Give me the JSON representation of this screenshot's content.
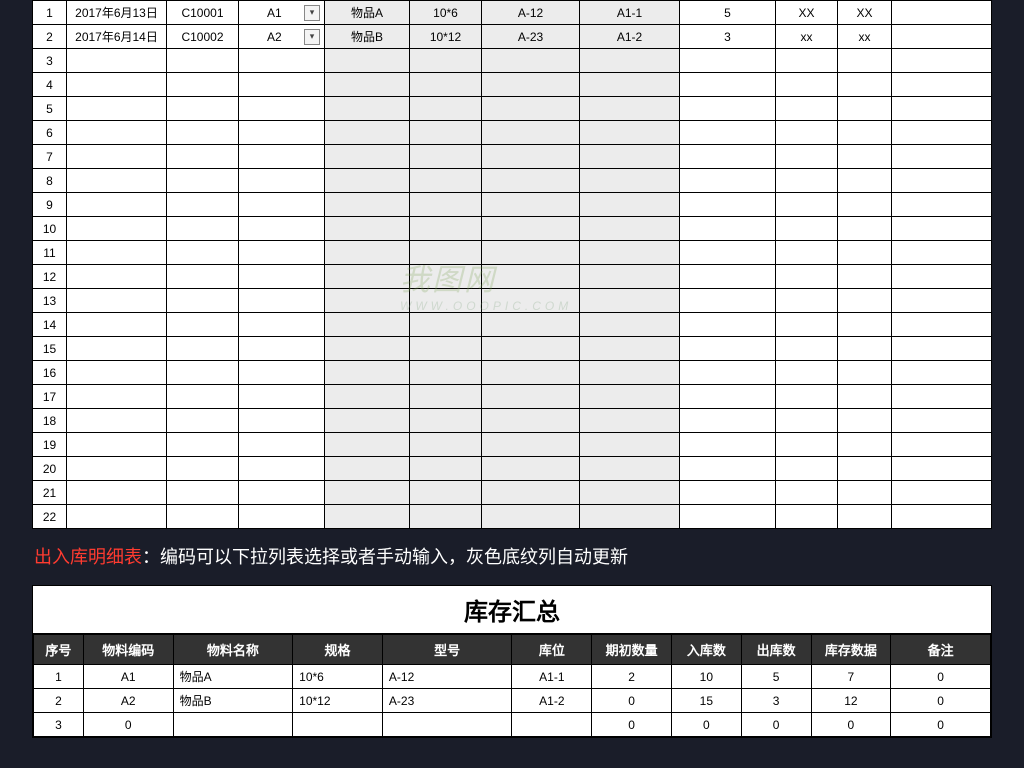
{
  "detail": {
    "rows": [
      {
        "n": "1",
        "date": "2017年6月13日",
        "code": "C10001",
        "sel": "A1",
        "name": "物品A",
        "spec": "10*6",
        "model": "A-12",
        "loc": "A1-1",
        "qty": "5",
        "x1": "XX",
        "x2": "XX"
      },
      {
        "n": "2",
        "date": "2017年6月14日",
        "code": "C10002",
        "sel": "A2",
        "name": "物品B",
        "spec": "10*12",
        "model": "A-23",
        "loc": "A1-2",
        "qty": "3",
        "x1": "xx",
        "x2": "xx"
      }
    ],
    "empty_rows": [
      "3",
      "4",
      "5",
      "6",
      "7",
      "8",
      "9",
      "10",
      "11",
      "12",
      "13",
      "14",
      "15",
      "16",
      "17",
      "18",
      "19",
      "20",
      "21",
      "22"
    ],
    "dropdown": {
      "options": [
        "A1",
        "A2"
      ],
      "selected": "A2"
    }
  },
  "caption": {
    "highlight": "出入库明细表",
    "rest": "：编码可以下拉列表选择或者手动输入，灰色底纹列自动更新"
  },
  "summary": {
    "title": "库存汇总",
    "headers": [
      "序号",
      "物料编码",
      "物料名称",
      "规格",
      "型号",
      "库位",
      "期初数量",
      "入库数",
      "出库数",
      "库存数据",
      "备注"
    ],
    "rows": [
      {
        "n": "1",
        "code": "A1",
        "name": "物品A",
        "spec": "10*6",
        "model": "A-12",
        "loc": "A1-1",
        "init": "2",
        "in": "10",
        "out": "5",
        "stock": "7",
        "rem": "0"
      },
      {
        "n": "2",
        "code": "A2",
        "name": "物品B",
        "spec": "10*12",
        "model": "A-23",
        "loc": "A1-2",
        "init": "0",
        "in": "15",
        "out": "3",
        "stock": "12",
        "rem": "0"
      },
      {
        "n": "3",
        "code": "0",
        "name": "",
        "spec": "",
        "model": "",
        "loc": "",
        "init": "0",
        "in": "0",
        "out": "0",
        "stock": "0",
        "rem": "0"
      }
    ]
  },
  "watermark": {
    "line1": "我图网",
    "line2": "WWW.OOOPIC.COM"
  }
}
